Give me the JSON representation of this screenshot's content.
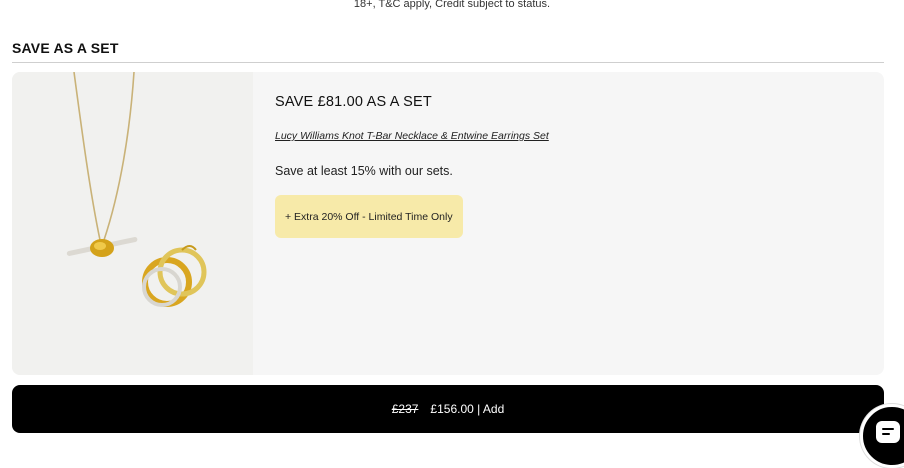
{
  "notice": {
    "text": "18+, T&C apply, Credit subject to status."
  },
  "section": {
    "title": "SAVE AS A SET"
  },
  "set": {
    "title": "SAVE £81.00 AS A SET",
    "product_link": "Lucy Williams Knot T-Bar Necklace & Entwine Earrings Set",
    "description": "Save at least 15% with our sets.",
    "promo": "+ Extra 20% Off - Limited Time Only"
  },
  "cart": {
    "old_price": "£237",
    "action_label": "£156.00 | Add"
  },
  "icons": {
    "chat": "chat-icon"
  },
  "colors": {
    "promo_bg": "#f7eaa9",
    "button_bg": "#000000",
    "card_bg": "#f6f6f6"
  }
}
